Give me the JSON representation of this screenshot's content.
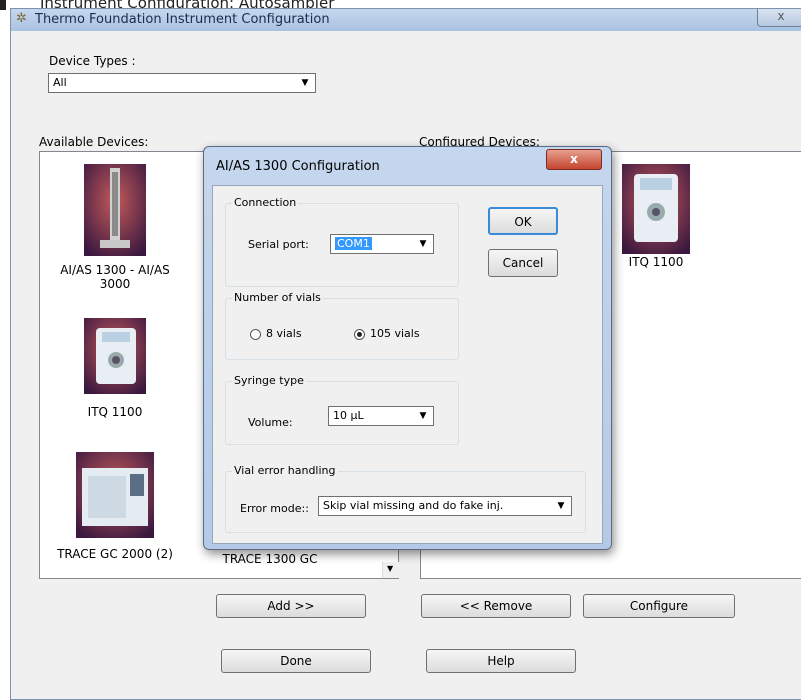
{
  "caption": "Instrument Configuration: Autosampler",
  "window": {
    "title": "Thermo Foundation Instrument Configuration",
    "close_glyph": "x"
  },
  "device_types": {
    "label": "Device Types :",
    "value": "All"
  },
  "available": {
    "label": "Available Devices:",
    "devices": [
      {
        "name": "AI/AS 1300 - AI/AS 3000",
        "icon": "autosampler-icon"
      },
      {
        "name": "ITQ 1100",
        "icon": "mass-spectrometer-icon"
      },
      {
        "name": "TRACE GC 2000 (2)",
        "icon": "gas-chromatograph-icon"
      },
      {
        "name": "TRACE 1300 GC",
        "icon": "gas-chromatograph-icon"
      }
    ]
  },
  "configured": {
    "label": "Configured Devices:",
    "devices": [
      {
        "name": "ITQ 1100",
        "icon": "mass-spectrometer-icon"
      }
    ]
  },
  "buttons": {
    "add": "Add >>",
    "remove": "<< Remove",
    "configure": "Configure",
    "done": "Done",
    "help": "Help"
  },
  "dialog": {
    "title": "AI/AS 1300 Configuration",
    "close_glyph": "x",
    "ok": "OK",
    "cancel": "Cancel",
    "connection": {
      "legend": "Connection",
      "serial_label": "Serial port:",
      "serial_value": "COM1"
    },
    "vials": {
      "legend": "Number of vials",
      "opt1": "8 vials",
      "opt2": "105 vials",
      "selected": "105 vials"
    },
    "syringe": {
      "legend": "Syringe type",
      "volume_label": "Volume:",
      "volume_value": "10 µL"
    },
    "error": {
      "legend": "Vial error handling",
      "mode_label": "Error mode::",
      "mode_value": "Skip vial missing and do fake inj."
    }
  }
}
